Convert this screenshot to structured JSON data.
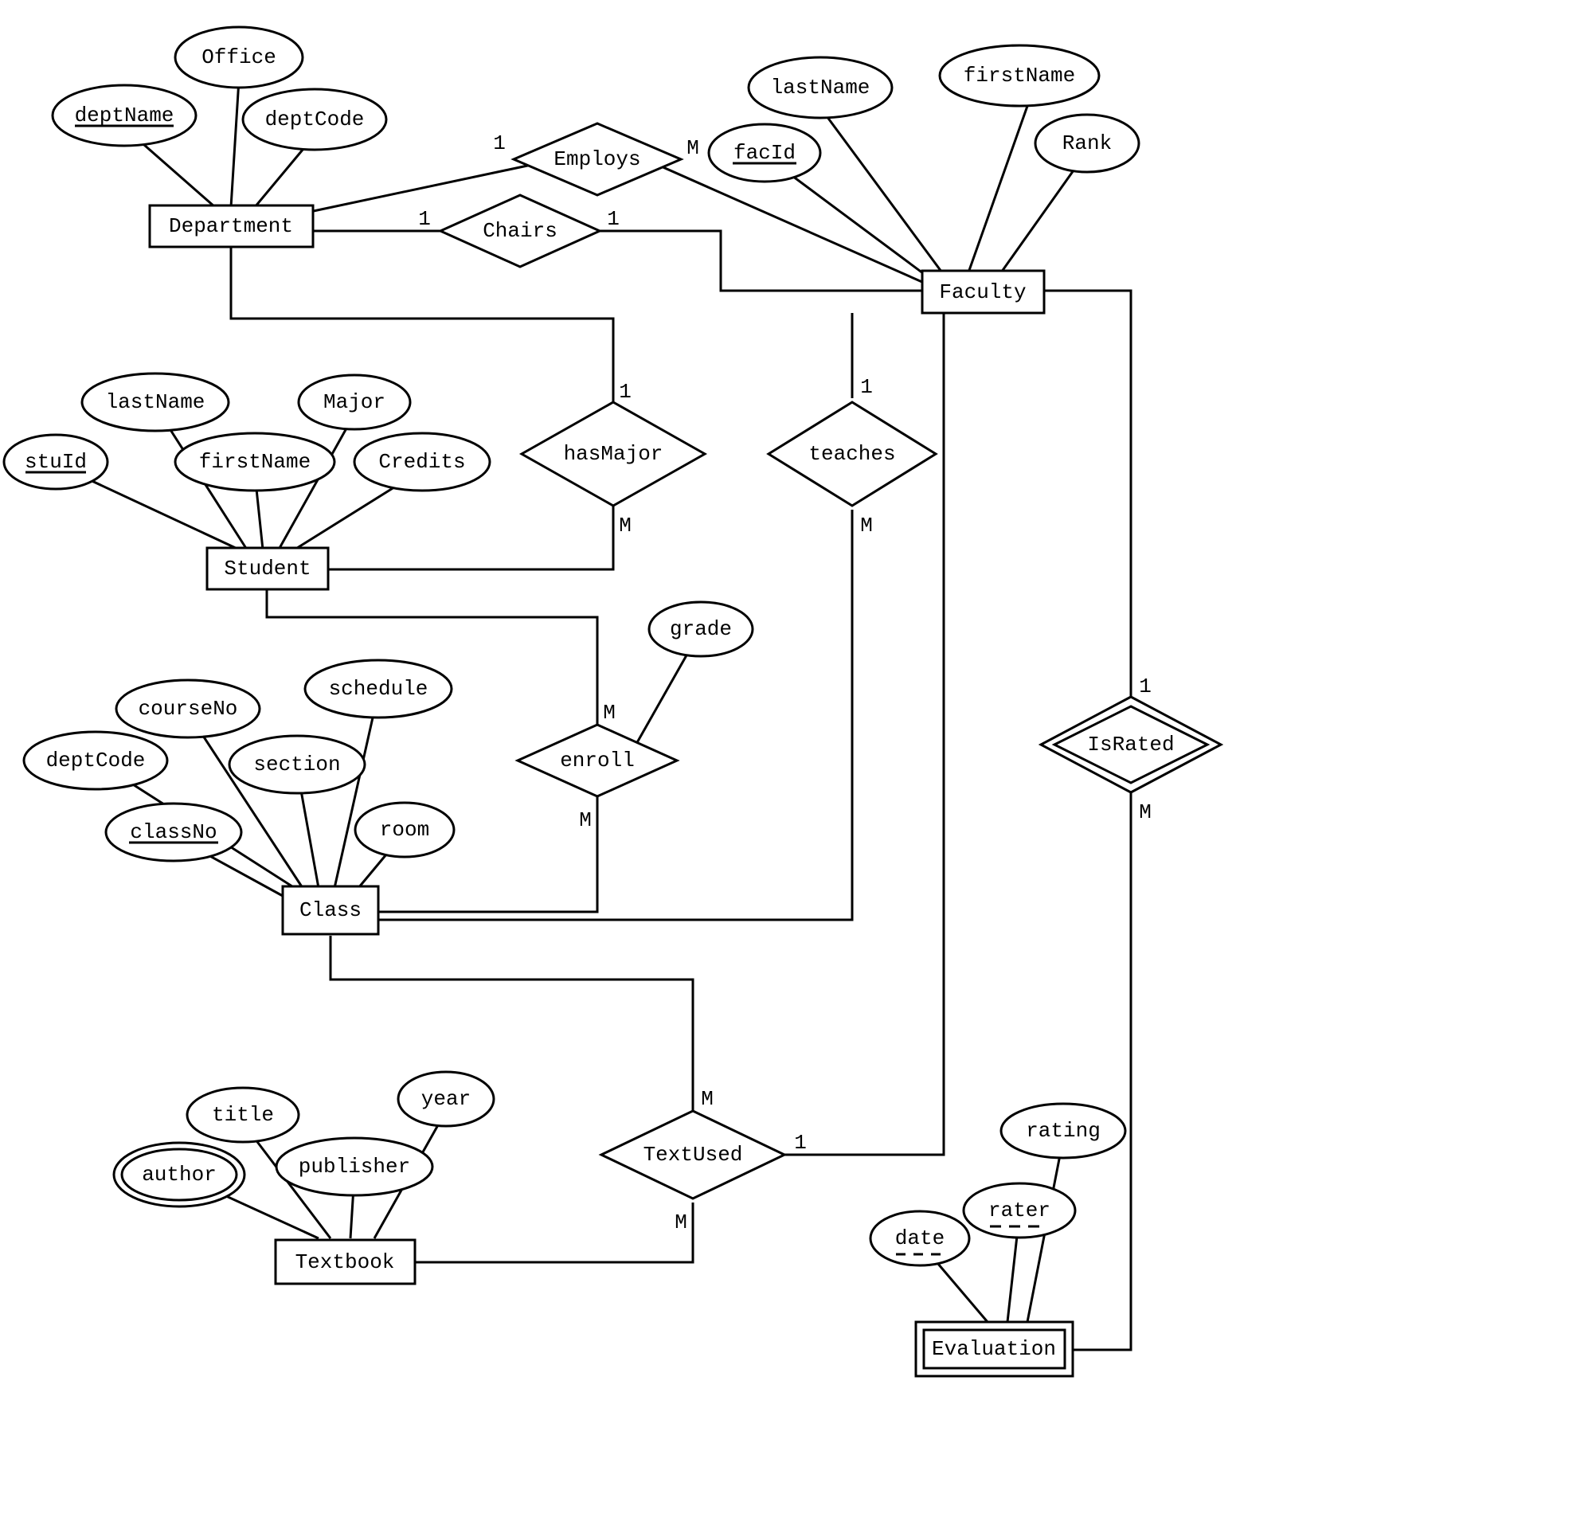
{
  "entities": {
    "department": "Department",
    "faculty": "Faculty",
    "student": "Student",
    "class": "Class",
    "textbook": "Textbook",
    "evaluation": "Evaluation"
  },
  "relationships": {
    "employs": "Employs",
    "chairs": "Chairs",
    "hasMajor": "hasMajor",
    "teaches": "teaches",
    "enroll": "enroll",
    "textUsed": "TextUsed",
    "isRated": "IsRated"
  },
  "attributes": {
    "department": {
      "deptName": "deptName",
      "office": "Office",
      "deptCode": "deptCode"
    },
    "faculty": {
      "lastName": "lastName",
      "firstName": "firstName",
      "facId": "facId",
      "rank": "Rank"
    },
    "student": {
      "stuId": "stuId",
      "lastName": "lastName",
      "firstName": "firstName",
      "major": "Major",
      "credits": "Credits"
    },
    "class": {
      "deptCode": "deptCode",
      "courseNo": "courseNo",
      "section": "section",
      "schedule": "schedule",
      "classNo": "classNo",
      "room": "room"
    },
    "textbook": {
      "author": "author",
      "title": "title",
      "publisher": "publisher",
      "year": "year"
    },
    "evaluation": {
      "date": "date",
      "rater": "rater",
      "rating": "rating"
    },
    "enroll": {
      "grade": "grade"
    }
  },
  "cardinalities": {
    "employs": {
      "department": "1",
      "faculty": "M"
    },
    "chairs": {
      "department": "1",
      "faculty": "1"
    },
    "hasMajor": {
      "department": "1",
      "student": "M"
    },
    "teaches": {
      "faculty": "1",
      "class": "M"
    },
    "enroll": {
      "student": "M",
      "class": "M"
    },
    "textUsed": {
      "class": "M",
      "textbook": "M",
      "faculty": "1"
    },
    "isRated": {
      "faculty": "1",
      "evaluation": "M"
    }
  }
}
